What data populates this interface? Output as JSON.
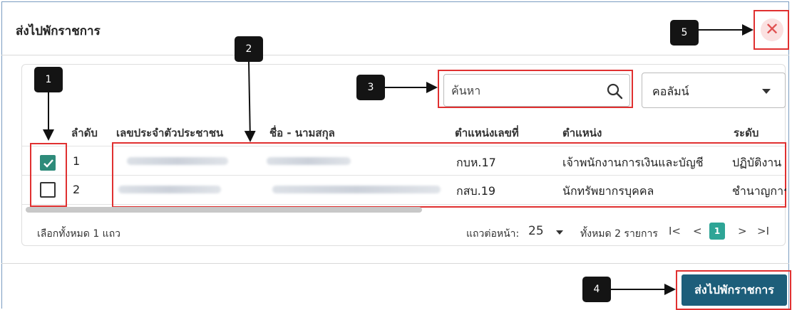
{
  "dialog": {
    "title": "ส่งไปพักราชการ",
    "close_symbol": "✕"
  },
  "toolbar": {
    "search_placeholder": "ค้นหา",
    "column_select_label": "คอลัมน์"
  },
  "table": {
    "headers": {
      "order": "ลำดับ",
      "citizen_id": "เลขประจำตัวประชาชน",
      "name": "ชื่อ - นามสกุล",
      "position_no": "ตำแหน่งเลขที่",
      "position": "ตำแหน่ง",
      "level": "ระดับ"
    },
    "rows": [
      {
        "checked": true,
        "order": "1",
        "position_no": "กบห.17",
        "position": "เจ้าพนักงานการเงินและบัญชี",
        "level": "ปฏิบัติงาน"
      },
      {
        "checked": false,
        "order": "2",
        "position_no": "กสบ.19",
        "position": "นักทรัพยากรบุคคล",
        "level": "ชำนาญการ"
      }
    ]
  },
  "footer": {
    "selected_text": "เลือกทั้งหมด 1 แถว",
    "rows_per_page_label": "แถวต่อหน้า:",
    "rows_per_page_value": "25",
    "total_text": "ทั้งหมด 2 รายการ",
    "first_symbol": "I<",
    "prev_symbol": "<",
    "current_page": "1",
    "next_symbol": ">",
    "last_symbol": ">I"
  },
  "actions": {
    "send_label": "ส่งไปพักราชการ"
  },
  "callouts": {
    "c1": "1",
    "c2": "2",
    "c3": "3",
    "c4": "4",
    "c5": "5"
  },
  "colors": {
    "accent_teal": "#2e8b7a",
    "page_current": "#2ea596",
    "primary_button": "#1d5e7a",
    "annotation_red": "#e03030",
    "close_bg": "#fbe1e1"
  }
}
